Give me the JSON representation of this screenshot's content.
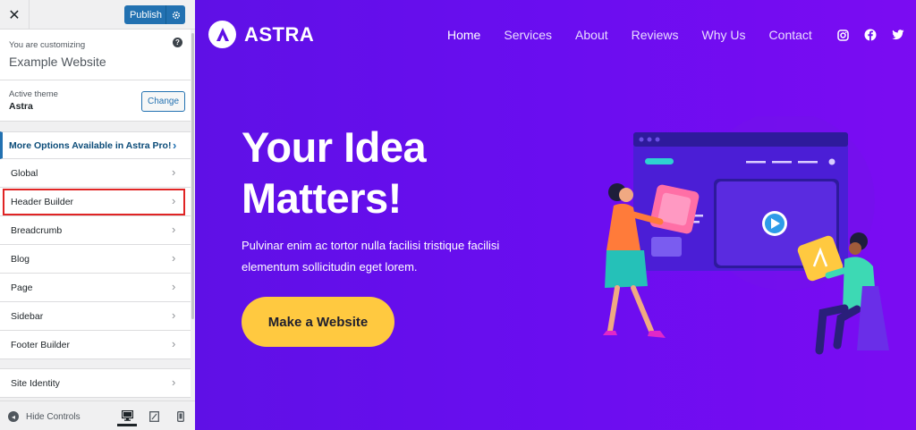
{
  "customizer": {
    "close_icon": "close-icon",
    "publish_label": "Publish",
    "publish_settings_icon": "gear-icon",
    "customizing_label": "You are customizing",
    "site_name": "Example Website",
    "help_icon": "help-icon",
    "active_theme_label": "Active theme",
    "theme_name": "Astra",
    "change_label": "Change",
    "pro_label": "More Options Available in Astra Pro!",
    "menu": [
      {
        "label": "Global"
      },
      {
        "label": "Header Builder",
        "highlighted": true
      },
      {
        "label": "Breadcrumb"
      },
      {
        "label": "Blog"
      },
      {
        "label": "Page"
      },
      {
        "label": "Sidebar"
      },
      {
        "label": "Footer Builder"
      },
      {
        "label": "Site Identity"
      }
    ],
    "hide_controls_label": "Hide Controls",
    "devices": [
      "desktop-icon",
      "tablet-icon",
      "mobile-icon"
    ],
    "active_device": "desktop"
  },
  "site": {
    "logo_text": "ASTRA",
    "nav": [
      "Home",
      "Services",
      "About",
      "Reviews",
      "Why Us",
      "Contact"
    ],
    "active_nav": "Home",
    "social": [
      "instagram-icon",
      "facebook-icon",
      "twitter-icon"
    ],
    "hero_title": "Your Idea Matters!",
    "hero_description": "Pulvinar enim ac tortor nulla facilisi tristique facilisi elementum sollicitudin eget lorem.",
    "cta_label": "Make a Website"
  },
  "colors": {
    "wp_blue": "#2271b1",
    "highlight": "#e02424",
    "hero_gradient_start": "#5f10e6",
    "hero_gradient_end": "#7b0cf2",
    "cta": "#ffc940"
  }
}
